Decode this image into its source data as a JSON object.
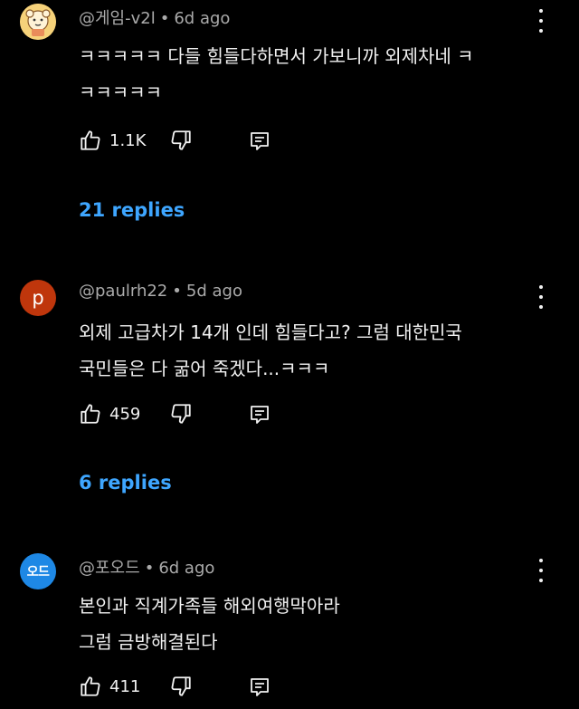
{
  "comments": [
    {
      "author": "@게임-v2l",
      "separator": "•",
      "time": "6d ago",
      "avatar_kind": "character illustration",
      "avatar_color": "#f4c96b",
      "lines": [
        "ㅋㅋㅋㅋㅋ 다들 힘들다하면서 가보니까 외제차네 ㅋ",
        "ㅋㅋㅋㅋㅋ"
      ],
      "likes": "1.1K",
      "replies": "21 replies"
    },
    {
      "author": "@paulrh22",
      "separator": "•",
      "time": "5d ago",
      "avatar_letter": "p",
      "avatar_color": "#bf360c",
      "lines": [
        "외제 고급차가 14개 인데 힘들다고? 그럼 대한민국",
        "국민들은 다 굶어 죽겠다...ㅋㅋㅋ"
      ],
      "likes": "459",
      "replies": "6 replies"
    },
    {
      "author": "@포오드",
      "separator": "•",
      "time": "6d ago",
      "avatar_text": "오드",
      "avatar_color": "#1e88e5",
      "lines": [
        "본인과 직계가족들 해외여행막아라",
        "그럼 금방해결된다"
      ],
      "likes": "411"
    }
  ],
  "icons": {
    "like": "thumbs-up-icon",
    "dislike": "thumbs-down-icon",
    "reply": "reply-icon",
    "more": "more-vert-icon"
  },
  "colors": {
    "background": "#000000",
    "text": "#f1f1f1",
    "meta": "#aaaaaa",
    "link": "#3ea6ff"
  }
}
